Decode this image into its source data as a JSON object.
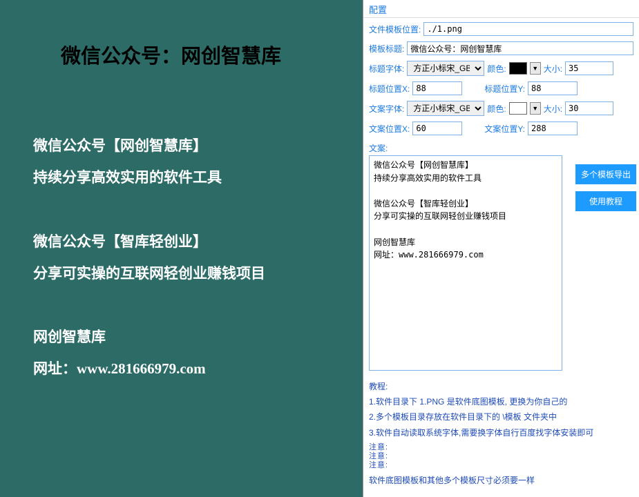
{
  "preview": {
    "title": "微信公众号：网创智慧库",
    "body": "微信公众号【网创智慧库】\n持续分享高效实用的软件工具\n\n微信公众号【智库轻创业】\n分享可实操的互联网轻创业赚钱项目\n\n网创智慧库\n网址：www.281666979.com"
  },
  "config": {
    "headers": {
      "config": "配置",
      "copy": "文案:",
      "tutorial": "教程:"
    },
    "labels": {
      "file_path": "文件模板位置:",
      "template_title": "模板标题:",
      "title_font": "标题字体:",
      "color": "颜色:",
      "size": "大小:",
      "title_x": "标题位置X:",
      "title_y": "标题位置Y:",
      "copy_font": "文案字体:",
      "copy_x": "文案位置X:",
      "copy_y": "文案位置Y:"
    },
    "values": {
      "file_path": "./1.png",
      "template_title": "微信公众号：网创智慧库",
      "title_font": "方正小标宋_GBK",
      "title_color": "#000000",
      "title_size": "35",
      "title_x": "88",
      "title_y": "88",
      "copy_font": "方正小标宋_GBK",
      "copy_color": "#ffffff",
      "copy_size": "30",
      "copy_x": "60",
      "copy_y": "288",
      "copy_text": "微信公众号【网创智慧库】\n持续分享高效实用的软件工具\n\n微信公众号【智库轻创业】\n分享可实操的互联网轻创业赚钱项目\n\n网创智慧库\n网址：www.281666979.com"
    },
    "buttons": {
      "multi_export": "多个模板导出",
      "tutorial_btn": "使用教程"
    },
    "tutorial": {
      "line1": "1.软件目录下 1.PNG 是软件底图模板, 更换为你自己的",
      "line2": "2.多个模板目录存放在软件目录下的 \\模板 文件夹中",
      "line3": "3.软件自动读取系统字体,需要换字体自行百度找字体安装即可"
    },
    "notice": {
      "a": "注",
      "b": "意",
      "c": ":"
    },
    "bottom_note": "软件底图模板和其他多个模板尺寸必须要一样"
  }
}
